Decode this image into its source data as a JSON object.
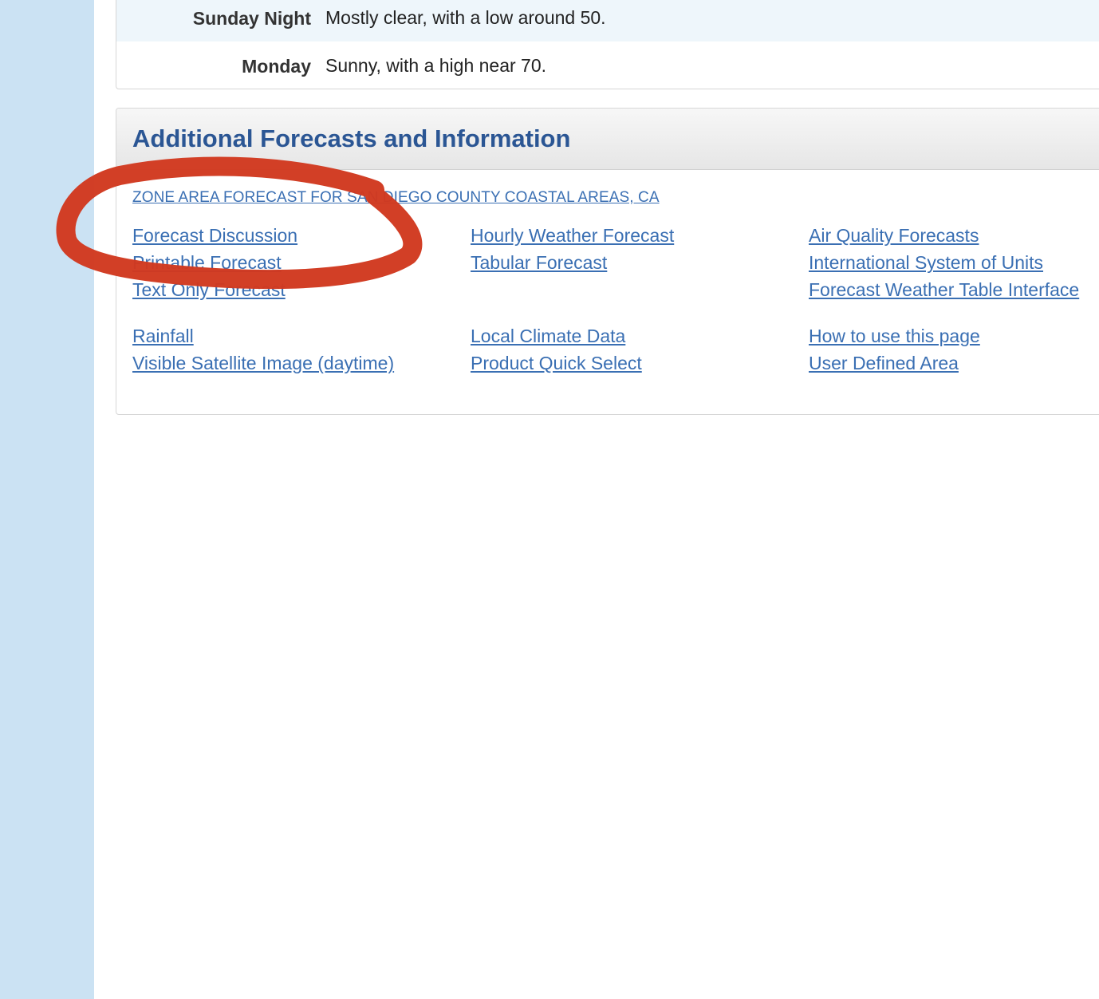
{
  "forecast_rows": [
    {
      "period": "Sunday Night",
      "text": "Mostly clear, with a low around 50."
    },
    {
      "period": "Monday",
      "text": "Sunny, with a high near 70."
    }
  ],
  "additional": {
    "title": "Additional Forecasts and Information",
    "zone_link": "ZONE AREA FORECAST FOR SAN DIEGO COUNTY COASTAL AREAS, CA",
    "links": {
      "forecast_discussion": "Forecast Discussion",
      "printable_forecast": "Printable Forecast",
      "text_only_forecast": "Text Only Forecast",
      "hourly_weather_forecast": "Hourly Weather Forecast",
      "tabular_forecast": "Tabular Forecast",
      "air_quality_forecasts": "Air Quality Forecasts",
      "international_system_of_units": "International System of Units",
      "forecast_weather_table_interface": "Forecast Weather Table Interface",
      "rainfall": "Rainfall",
      "visible_satellite_image": "Visible Satellite Image (daytime)",
      "local_climate_data": "Local Climate Data",
      "product_quick_select": "Product Quick Select",
      "how_to_use_this_page": "How to use this page",
      "user_defined_area": "User Defined Area"
    }
  },
  "colors": {
    "link": "#3a6fb3",
    "title": "#2b5694",
    "rail": "#cbe2f3",
    "annotation": "#d1391f"
  }
}
